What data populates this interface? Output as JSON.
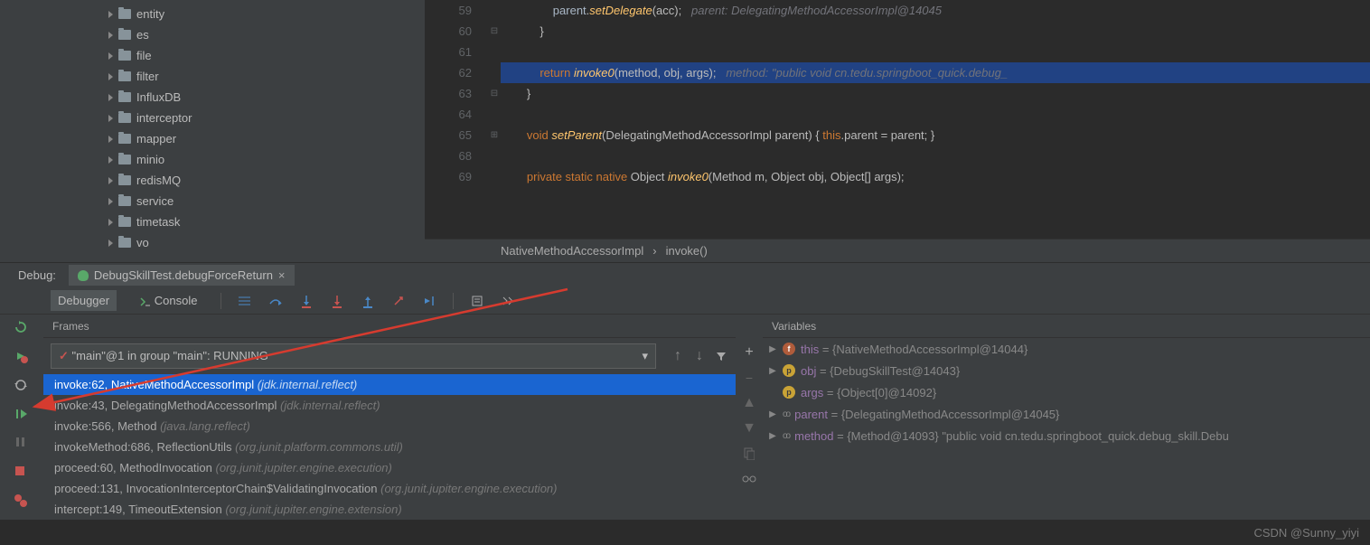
{
  "tree": {
    "items": [
      "entity",
      "es",
      "file",
      "filter",
      "InfluxDB",
      "interceptor",
      "mapper",
      "minio",
      "redisMQ",
      "service",
      "timetask",
      "vo"
    ]
  },
  "editor": {
    "lines": [
      {
        "n": "59",
        "code": "                parent.setDelegate(acc);   parent: DelegatingMethodAccessorImpl@14045"
      },
      {
        "n": "60",
        "code": "            }"
      },
      {
        "n": "61",
        "code": ""
      },
      {
        "n": "62",
        "code": "            return invoke0(method, obj, args);   method: \"public void cn.tedu.springboot_quick.debug_",
        "hl": true
      },
      {
        "n": "63",
        "code": "        }"
      },
      {
        "n": "64",
        "code": ""
      },
      {
        "n": "65",
        "code": "        void setParent(DelegatingMethodAccessorImpl parent) { this.parent = parent; }"
      },
      {
        "n": "68",
        "code": ""
      },
      {
        "n": "69",
        "code": "        private static native Object invoke0(Method m, Object obj, Object[] args);"
      }
    ],
    "breadcrumb": {
      "cls": "NativeMethodAccessorImpl",
      "mth": "invoke()"
    }
  },
  "debug": {
    "label": "Debug:",
    "config": "DebugSkillTest.debugForceReturn",
    "tabs": {
      "debugger": "Debugger",
      "console": "Console"
    },
    "frames": {
      "title": "Frames",
      "thread": "\"main\"@1 in group \"main\": RUNNING",
      "list": [
        {
          "m": "invoke:62, NativeMethodAccessorImpl ",
          "p": "(jdk.internal.reflect)",
          "sel": true
        },
        {
          "m": "invoke:43, DelegatingMethodAccessorImpl ",
          "p": "(jdk.internal.reflect)"
        },
        {
          "m": "invoke:566, Method ",
          "p": "(java.lang.reflect)"
        },
        {
          "m": "invokeMethod:686, ReflectionUtils ",
          "p": "(org.junit.platform.commons.util)"
        },
        {
          "m": "proceed:60, MethodInvocation ",
          "p": "(org.junit.jupiter.engine.execution)"
        },
        {
          "m": "proceed:131, InvocationInterceptorChain$ValidatingInvocation ",
          "p": "(org.junit.jupiter.engine.execution)"
        },
        {
          "m": "intercept:149, TimeoutExtension ",
          "p": "(org.junit.jupiter.engine.extension)"
        }
      ]
    },
    "vars": {
      "title": "Variables",
      "list": [
        {
          "ic": "f",
          "n": "this",
          "v": " = {NativeMethodAccessorImpl@14044}",
          "ex": true
        },
        {
          "ic": "p",
          "n": "obj",
          "v": " = {DebugSkillTest@14043}",
          "ex": true
        },
        {
          "ic": "p",
          "n": "args",
          "v": " = {Object[0]@14092}",
          "ex": false
        },
        {
          "ic": "oo",
          "n": "parent",
          "v": " = {DelegatingMethodAccessorImpl@14045}",
          "ex": true
        },
        {
          "ic": "oo",
          "n": "method",
          "v": " = {Method@14093} \"public void cn.tedu.springboot_quick.debug_skill.Debu",
          "ex": true
        }
      ]
    }
  },
  "watermark": "CSDN @Sunny_yiyi"
}
